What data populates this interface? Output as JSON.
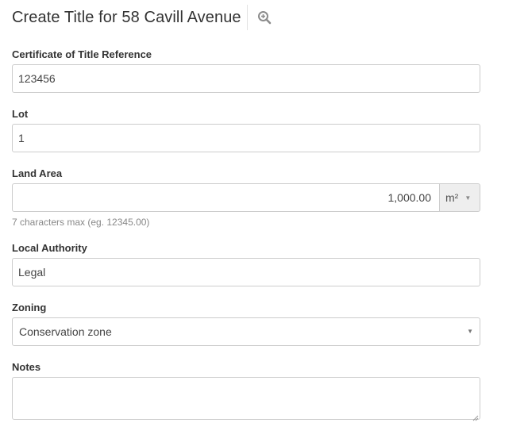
{
  "header": {
    "title": "Create Title for 58 Cavill Avenue",
    "zoom_icon": "zoom-in-icon"
  },
  "form": {
    "certificate": {
      "label": "Certificate of Title Reference",
      "value": "123456"
    },
    "lot": {
      "label": "Lot",
      "value": "1"
    },
    "land_area": {
      "label": "Land Area",
      "value": "1,000.00",
      "unit": "m²",
      "help": "7 characters max (eg. 12345.00)"
    },
    "local_authority": {
      "label": "Local Authority",
      "value": "Legal"
    },
    "zoning": {
      "label": "Zoning",
      "selected": "Conservation zone"
    },
    "notes": {
      "label": "Notes",
      "value": ""
    }
  },
  "colors": {
    "border": "#cccccc",
    "addon_bg": "#eeeeee",
    "help_text": "#888888"
  }
}
